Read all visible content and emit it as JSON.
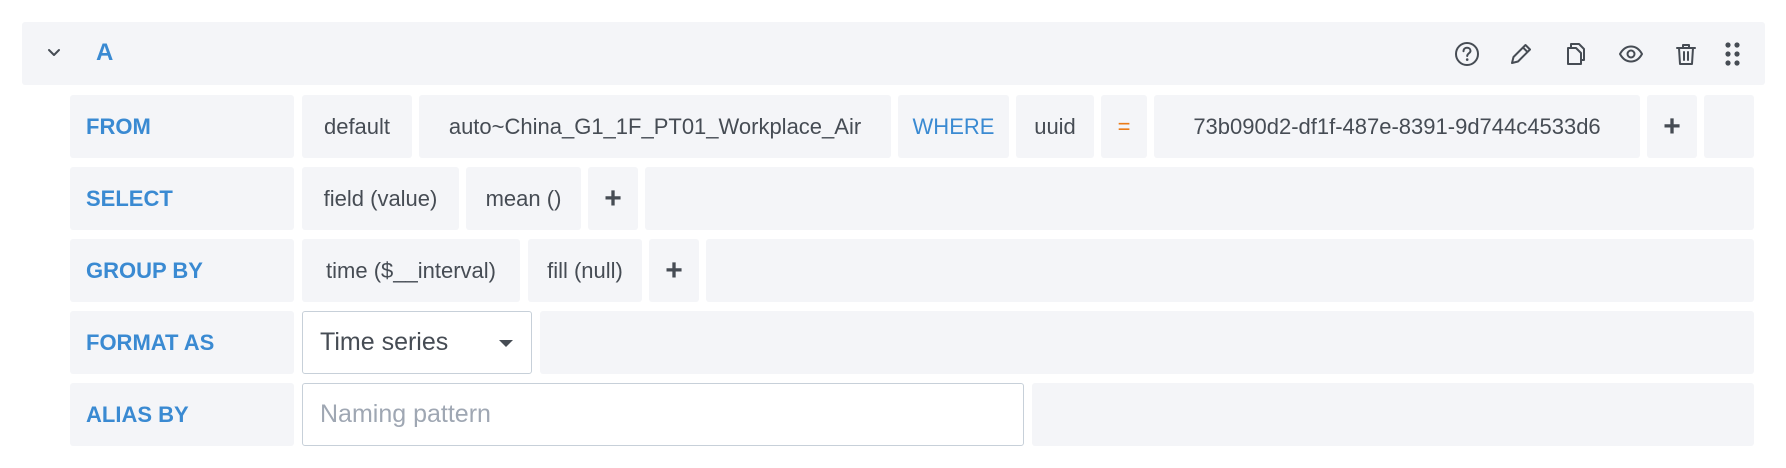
{
  "query": {
    "ref_id": "A"
  },
  "header_actions": [
    {
      "name": "help-icon",
      "title": "Help"
    },
    {
      "name": "edit-icon",
      "title": "Edit"
    },
    {
      "name": "duplicate-icon",
      "title": "Duplicate"
    },
    {
      "name": "eye-icon",
      "title": "Toggle visibility"
    },
    {
      "name": "trash-icon",
      "title": "Delete"
    },
    {
      "name": "drag-handle-icon",
      "title": "Drag"
    }
  ],
  "from_row": {
    "label": "FROM",
    "policy": "default",
    "measurement": "auto~China_G1_1F_PT01_Workplace_Air",
    "where_label": "WHERE",
    "tag_key": "uuid",
    "operator": "=",
    "tag_value": "73b090d2-df1f-487e-8391-9d744c4533d6",
    "add": "+"
  },
  "select_row": {
    "label": "SELECT",
    "field": "field (value)",
    "aggregation": "mean ()",
    "add": "+"
  },
  "group_row": {
    "label": "GROUP BY",
    "time": "time ($__interval)",
    "fill": "fill (null)",
    "add": "+"
  },
  "format_row": {
    "label": "FORMAT AS",
    "selected": "Time series"
  },
  "alias_row": {
    "label": "ALIAS BY",
    "value": "",
    "placeholder": "Naming pattern"
  },
  "colors": {
    "label_blue": "#3a8ad2",
    "operator_orange": "#eb7b18",
    "panel_bg": "#f4f5f8",
    "text": "#464c54"
  }
}
